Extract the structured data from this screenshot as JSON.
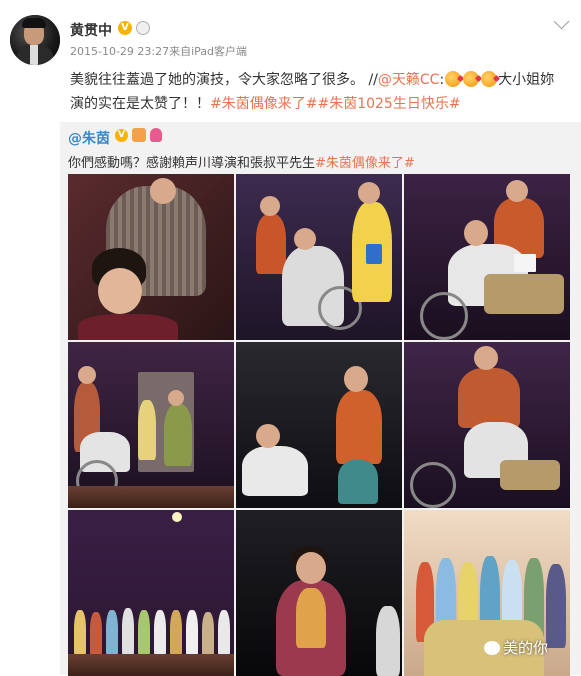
{
  "post": {
    "username": "黄贯中",
    "vip_badge": "V",
    "timestamp": "2015-10-29 23:27来自iPad客户端",
    "content": {
      "line1_text": "美貌往往蓋過了她的演技，令大家忽略了很多。 //",
      "mention": "@天籁CC",
      "colon": ":",
      "line1_tail": "大小姐妳",
      "line2_text": "演的实在是太赞了！！",
      "topic1": "#朱茵偶像来了#",
      "topic2": "#朱茵1025生日快乐#"
    }
  },
  "repost": {
    "author": "@朱茵",
    "vip_badge": "V",
    "text_plain": "你們感動嗎？感謝賴声川導演和張叔平先生",
    "topic": "#朱茵偶像来了#",
    "images": [
      "photo-1",
      "photo-2",
      "photo-3",
      "photo-4",
      "photo-5",
      "photo-6",
      "photo-7",
      "photo-8",
      "photo-9"
    ],
    "watermark": "美的你"
  },
  "colors": {
    "mention": "#eb7350",
    "topic": "#3a8ac8",
    "repost_bg": "#f2f2f2",
    "vip": "#f6b300"
  }
}
